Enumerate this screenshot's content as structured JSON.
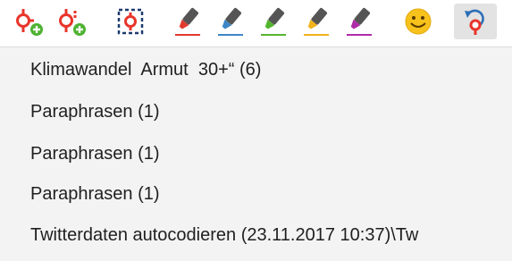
{
  "toolbar": {
    "buttons": [
      {
        "name": "new-code-icon"
      },
      {
        "name": "new-subcode-icon"
      },
      {
        "name": "code-selection-icon"
      },
      {
        "name": "highlight-red-icon",
        "color": "#e03a2f"
      },
      {
        "name": "highlight-blue-icon",
        "color": "#3d86c6"
      },
      {
        "name": "highlight-green-icon",
        "color": "#55b52e"
      },
      {
        "name": "highlight-yellow-icon",
        "color": "#f1b31c"
      },
      {
        "name": "highlight-magenta-icon",
        "color": "#b02aa8"
      },
      {
        "name": "emoticode-icon"
      },
      {
        "name": "undo-code-icon",
        "active": true
      }
    ]
  },
  "menu": {
    "items": [
      {
        "label": "Klimawandel  Armut  30+“ (6)"
      },
      {
        "label": "Paraphrasen (1)"
      },
      {
        "label": "Paraphrasen (1)"
      },
      {
        "label": "Paraphrasen (1)"
      },
      {
        "label": "Twitterdaten autocodieren (23.11.2017 10:37)\\Tw"
      }
    ]
  }
}
